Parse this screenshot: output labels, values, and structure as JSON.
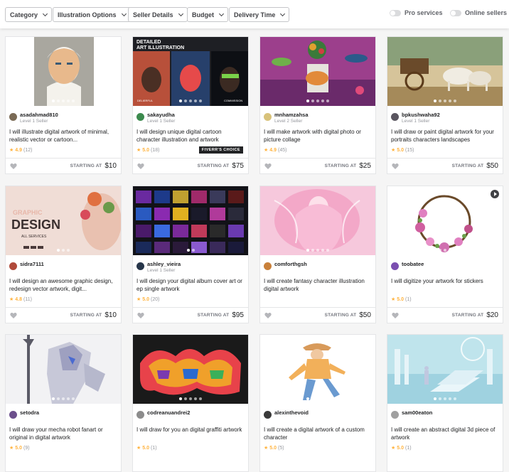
{
  "filters": {
    "category": "Category",
    "illustration": "Illustration Options",
    "seller_details": "Seller Details",
    "budget": "Budget",
    "delivery": "Delivery Time",
    "pro": "Pro services",
    "online": "Online sellers"
  },
  "starting_label": "STARTING AT",
  "gigs": [
    {
      "seller": "asadahmad810",
      "level": "Level 1 Seller",
      "title": "I will illustrate digital artwork of minimal, realistic vector or cartoon...",
      "rating": "4.9",
      "count": "(12)",
      "price": "$10",
      "badge": "",
      "avatar": "#7a6a55"
    },
    {
      "seller": "sakayudha",
      "level": "Level 1 Seller",
      "title": "I will design unique digital cartoon character illustration and artwork",
      "rating": "5.0",
      "count": "(18)",
      "price": "$75",
      "badge": "FIVERR'S CHOICE",
      "avatar": "#3c8a4e"
    },
    {
      "seller": "mnhamzahsa",
      "level": "Level 2 Seller",
      "title": "I will make artwork with digital photo or picture collage",
      "rating": "4.9",
      "count": "(45)",
      "price": "$25",
      "badge": "",
      "avatar": "#d8c27a"
    },
    {
      "seller": "bpkushwaha92",
      "level": "Level 1 Seller",
      "title": "I will draw or paint digital artwork for your portraits characters landscapes",
      "rating": "5.0",
      "count": "(15)",
      "price": "$50",
      "badge": "",
      "avatar": "#5a5560"
    },
    {
      "seller": "sidra7111",
      "level": "",
      "title": "I will design an awesome graphic design, redesign vector artwork, digit...",
      "rating": "4.8",
      "count": "(11)",
      "price": "$10",
      "badge": "",
      "avatar": "#b04a3a"
    },
    {
      "seller": "ashley_vieira",
      "level": "Level 1 Seller",
      "title": "I will design your digital album cover art or ep single artwork",
      "rating": "5.0",
      "count": "(20)",
      "price": "$95",
      "badge": "",
      "avatar": "#27364a"
    },
    {
      "seller": "comforthgsh",
      "level": "",
      "title": "I will create fantasy character illustration digital artwork",
      "rating": "",
      "count": "",
      "price": "$50",
      "badge": "",
      "avatar": "#c9803a"
    },
    {
      "seller": "toobatee",
      "level": "",
      "title": "I will digitize your artwork for stickers",
      "rating": "5.0",
      "count": "(1)",
      "price": "$20",
      "badge": "",
      "avatar": "#7b4fb0"
    },
    {
      "seller": "setodra",
      "level": "",
      "title": "I will draw your mecha robot fanart or original in digital artwork",
      "rating": "5.0",
      "count": "(9)",
      "price": "",
      "badge": "",
      "avatar": "#6c4f8c"
    },
    {
      "seller": "codreanuandrei2",
      "level": "",
      "title": "I will draw for you an digital graffiti artwork",
      "rating": "5.0",
      "count": "(1)",
      "price": "",
      "badge": "",
      "avatar": "#8c8c8c"
    },
    {
      "seller": "alexinthevoid",
      "level": "",
      "title": "I will create a digital artwork of a custom character",
      "rating": "5.0",
      "count": "(5)",
      "price": "",
      "badge": "",
      "avatar": "#3a3a3a"
    },
    {
      "seller": "sam00eaton",
      "level": "",
      "title": "I will create an abstract digital 3d piece of artwork",
      "rating": "5.0",
      "count": "(1)",
      "price": "",
      "badge": "",
      "avatar": "#a0a0a0"
    }
  ],
  "thumb_text": {
    "g2_top1": "DETAILED",
    "g2_top2": "ART ILLUSTRATION",
    "g2_l": "DELIERFUL",
    "g2_r": "COMMISSION",
    "g5_big1": "GRAPHIC",
    "g5_big2": "DESIGN",
    "g5_sub": "ALL SERVICES"
  }
}
